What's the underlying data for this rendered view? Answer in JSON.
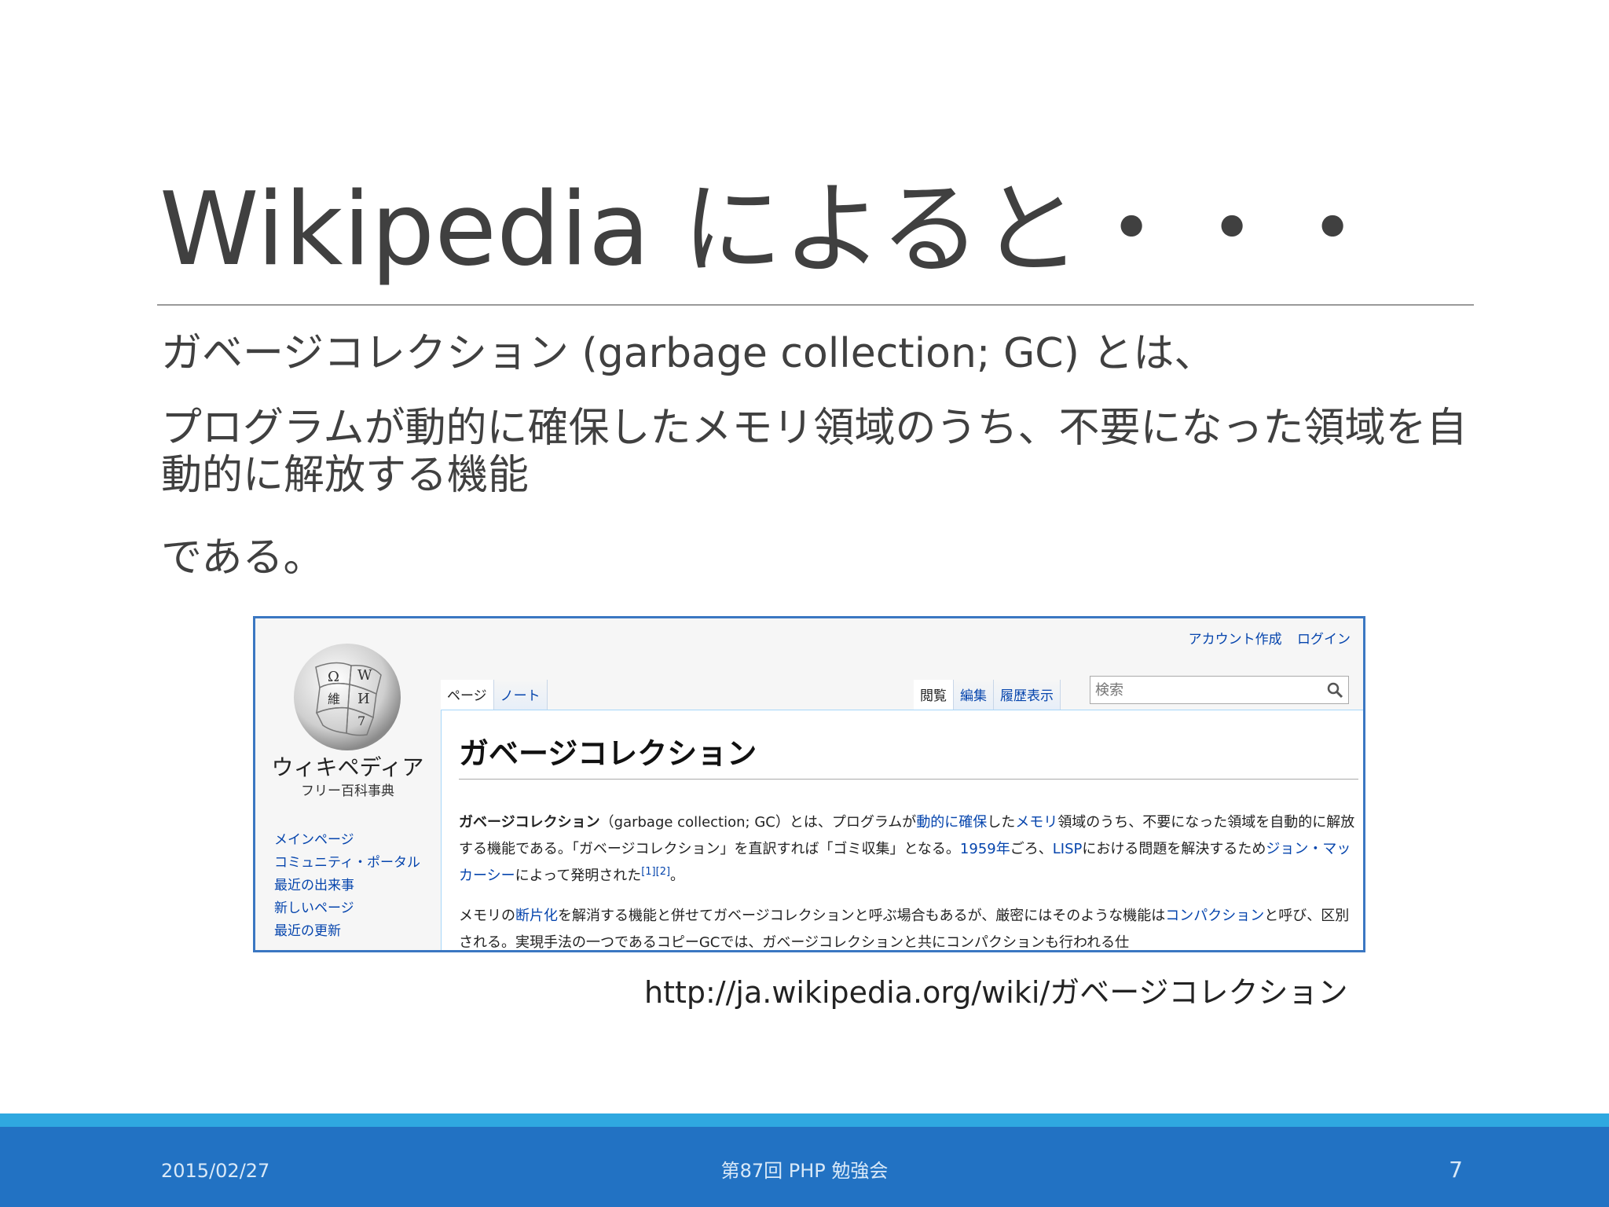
{
  "slide": {
    "title": "Wikipedia によると・・・",
    "lines": [
      "ガベージコレクション (garbage collection; GC) とは、",
      "プログラムが動的に確保したメモリ領域のうち、不要になった領域を自動的に解放する機能",
      "である。"
    ],
    "url": "http://ja.wikipedia.org/wiki/ガベージコレクション"
  },
  "wiki": {
    "site_name": "ウィキペディア",
    "tagline": "フリー百科事典",
    "nav": [
      "メインページ",
      "コミュニティ・ポータル",
      "最近の出来事",
      "新しいページ",
      "最近の更新"
    ],
    "account": {
      "create": "アカウント作成",
      "login": "ログイン"
    },
    "tabs_left": {
      "page": "ページ",
      "talk": "ノート"
    },
    "tabs_right": {
      "read": "閲覧",
      "edit": "編集",
      "history": "履歴表示"
    },
    "search_placeholder": "検索",
    "heading": "ガベージコレクション",
    "para1": {
      "bold": "ガベージコレクション",
      "t1": "（garbage collection; GC）とは、プログラムが",
      "l1": "動的に確保",
      "t2": "した",
      "l2": "メモリ",
      "t3": "領域のうち、不要になった領域を自動的に解放する機能である。「ガベージコレクション」を直訳すれば「ゴミ収集」となる。",
      "l3": "1959年",
      "t4": "ごろ、",
      "l4": "LISP",
      "t5": "における問題を解決するため",
      "l5": "ジョン・マッカーシー",
      "t6": "によって発明された",
      "ref": "[1][2]",
      "t7": "。"
    },
    "para2": {
      "t1": "メモリの",
      "l1": "断片化",
      "t2": "を解消する機能と併せてガベージコレクションと呼ぶ場合もあるが、厳密にはそのような機能は",
      "l2": "コンパクション",
      "t3": "と呼び、区別される。実現手法の一つであるコピーGCでは、ガベージコレクションと共にコンパクションも行われる仕"
    }
  },
  "footer": {
    "date": "2015/02/27",
    "event": "第87回 PHP 勉強会",
    "page": "7"
  },
  "colors": {
    "footer_bar": "#2272c3",
    "footer_stripe": "#2fa8e0",
    "link": "#0645ad",
    "screenshot_border": "#3b77c2"
  }
}
